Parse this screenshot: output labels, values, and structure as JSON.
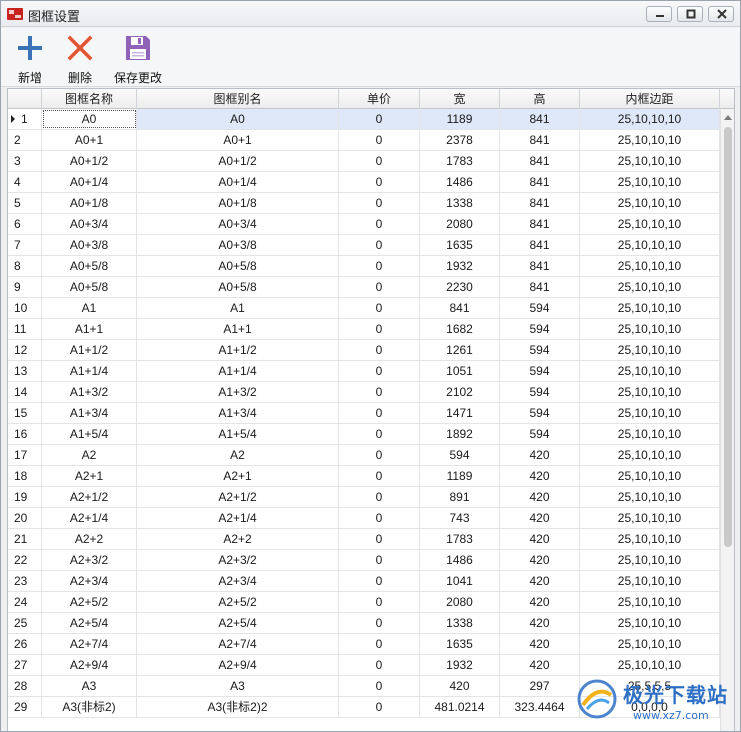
{
  "window": {
    "title": "图框设置",
    "icon": "app-logo-icon"
  },
  "toolbar": {
    "add_label": "新增",
    "delete_label": "删除",
    "save_label": "保存更改",
    "add_color": "#3a73b8",
    "delete_color": "#e05533",
    "save_color": "#9063b8"
  },
  "grid": {
    "columns": [
      "图框名称",
      "图框别名",
      "单价",
      "宽",
      "高",
      "内框边距"
    ],
    "selected_index": 0,
    "selection_color": "#dfe8f8",
    "rows": [
      [
        "1",
        "A0",
        "A0",
        "0",
        "1189",
        "841",
        "25,10,10,10"
      ],
      [
        "2",
        "A0+1",
        "A0+1",
        "0",
        "2378",
        "841",
        "25,10,10,10"
      ],
      [
        "3",
        "A0+1/2",
        "A0+1/2",
        "0",
        "1783",
        "841",
        "25,10,10,10"
      ],
      [
        "4",
        "A0+1/4",
        "A0+1/4",
        "0",
        "1486",
        "841",
        "25,10,10,10"
      ],
      [
        "5",
        "A0+1/8",
        "A0+1/8",
        "0",
        "1338",
        "841",
        "25,10,10,10"
      ],
      [
        "6",
        "A0+3/4",
        "A0+3/4",
        "0",
        "2080",
        "841",
        "25,10,10,10"
      ],
      [
        "7",
        "A0+3/8",
        "A0+3/8",
        "0",
        "1635",
        "841",
        "25,10,10,10"
      ],
      [
        "8",
        "A0+5/8",
        "A0+5/8",
        "0",
        "1932",
        "841",
        "25,10,10,10"
      ],
      [
        "9",
        "A0+5/8",
        "A0+5/8",
        "0",
        "2230",
        "841",
        "25,10,10,10"
      ],
      [
        "10",
        "A1",
        "A1",
        "0",
        "841",
        "594",
        "25,10,10,10"
      ],
      [
        "11",
        "A1+1",
        "A1+1",
        "0",
        "1682",
        "594",
        "25,10,10,10"
      ],
      [
        "12",
        "A1+1/2",
        "A1+1/2",
        "0",
        "1261",
        "594",
        "25,10,10,10"
      ],
      [
        "13",
        "A1+1/4",
        "A1+1/4",
        "0",
        "1051",
        "594",
        "25,10,10,10"
      ],
      [
        "14",
        "A1+3/2",
        "A1+3/2",
        "0",
        "2102",
        "594",
        "25,10,10,10"
      ],
      [
        "15",
        "A1+3/4",
        "A1+3/4",
        "0",
        "1471",
        "594",
        "25,10,10,10"
      ],
      [
        "16",
        "A1+5/4",
        "A1+5/4",
        "0",
        "1892",
        "594",
        "25,10,10,10"
      ],
      [
        "17",
        "A2",
        "A2",
        "0",
        "594",
        "420",
        "25,10,10,10"
      ],
      [
        "18",
        "A2+1",
        "A2+1",
        "0",
        "1189",
        "420",
        "25,10,10,10"
      ],
      [
        "19",
        "A2+1/2",
        "A2+1/2",
        "0",
        "891",
        "420",
        "25,10,10,10"
      ],
      [
        "20",
        "A2+1/4",
        "A2+1/4",
        "0",
        "743",
        "420",
        "25,10,10,10"
      ],
      [
        "21",
        "A2+2",
        "A2+2",
        "0",
        "1783",
        "420",
        "25,10,10,10"
      ],
      [
        "22",
        "A2+3/2",
        "A2+3/2",
        "0",
        "1486",
        "420",
        "25,10,10,10"
      ],
      [
        "23",
        "A2+3/4",
        "A2+3/4",
        "0",
        "1041",
        "420",
        "25,10,10,10"
      ],
      [
        "24",
        "A2+5/2",
        "A2+5/2",
        "0",
        "2080",
        "420",
        "25,10,10,10"
      ],
      [
        "25",
        "A2+5/4",
        "A2+5/4",
        "0",
        "1338",
        "420",
        "25,10,10,10"
      ],
      [
        "26",
        "A2+7/4",
        "A2+7/4",
        "0",
        "1635",
        "420",
        "25,10,10,10"
      ],
      [
        "27",
        "A2+9/4",
        "A2+9/4",
        "0",
        "1932",
        "420",
        "25,10,10,10"
      ],
      [
        "28",
        "A3",
        "A3",
        "0",
        "420",
        "297",
        "25,5,5,5"
      ],
      [
        "29",
        "A3(非标2)",
        "A3(非标2)2",
        "0",
        "481.0214",
        "323.4464",
        "0,0,0,0"
      ]
    ]
  },
  "watermark": {
    "main": "极光下载站",
    "sub": "www.xz7.com"
  }
}
